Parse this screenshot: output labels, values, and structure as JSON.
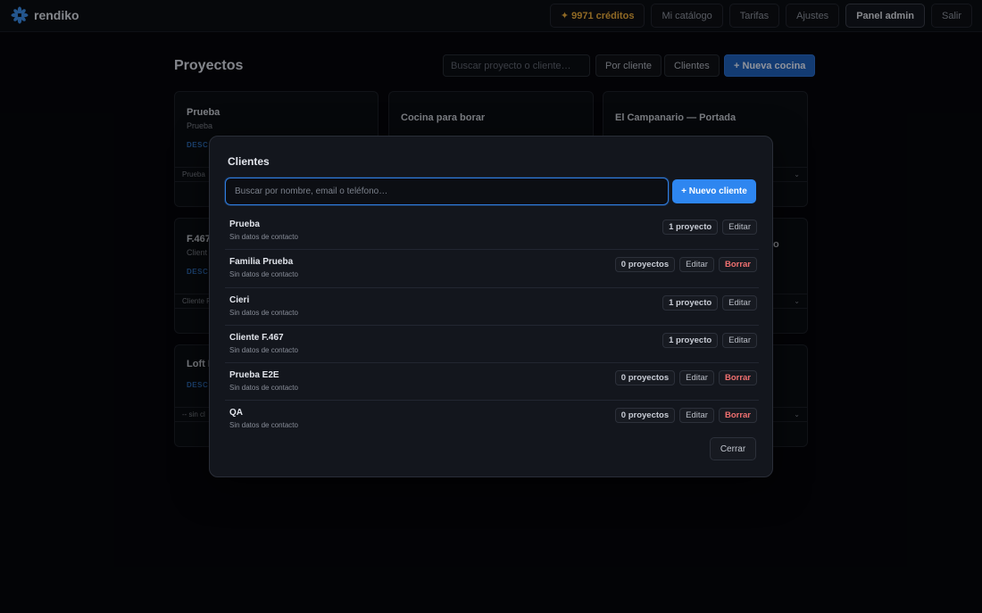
{
  "brand": {
    "name": "rendiko",
    "color": "#3a8ce6",
    "icon": "snowflake-logo-icon"
  },
  "nav": {
    "credits": "✦ 9971 créditos",
    "catalog": "Mi catálogo",
    "rates": "Tarifas",
    "settings": "Ajustes",
    "admin": "Panel admin",
    "logout": "Salir"
  },
  "header": {
    "title": "Proyectos",
    "search_placeholder": "Buscar proyecto o cliente…",
    "by_client": "Por cliente",
    "clients": "Clientes",
    "new_kitchen": "+ Nueva cocina"
  },
  "cards": [
    {
      "title": "Prueba",
      "subtitle": "Prueba",
      "tag": "DESC",
      "select": "Prueba"
    },
    {
      "title": "Cocina para borar",
      "subtitle": "",
      "tag": "",
      "select": ""
    },
    {
      "title": "El Campanario — Portada",
      "subtitle": "",
      "tag": "",
      "select": ""
    },
    {
      "title": "F.467",
      "subtitle": "Client",
      "tag": "DESC",
      "select": "Cliente F"
    },
    {
      "title": "",
      "subtitle": "",
      "tag": "",
      "select": ""
    },
    {
      "title": "o",
      "subtitle": "",
      "tag": "",
      "select": ""
    },
    {
      "title": "Loft F",
      "subtitle": "",
      "tag": "DESC",
      "select": "-- sin cl"
    },
    {
      "title": "",
      "subtitle": "",
      "tag": "",
      "select": ""
    }
  ],
  "modal": {
    "title": "Clientes",
    "search_placeholder": "Buscar por nombre, email o teléfono…",
    "new_client": "+ Nuevo cliente",
    "close": "Cerrar",
    "edit_label": "Editar",
    "delete_label": "Borrar",
    "clients": [
      {
        "name": "Prueba",
        "contact": "Sin datos de contacto",
        "projects": "1 proyecto",
        "deletable": false
      },
      {
        "name": "Familia Prueba",
        "contact": "Sin datos de contacto",
        "projects": "0 proyectos",
        "deletable": true
      },
      {
        "name": "Cieri",
        "contact": "Sin datos de contacto",
        "projects": "1 proyecto",
        "deletable": false
      },
      {
        "name": "Cliente F.467",
        "contact": "Sin datos de contacto",
        "projects": "1 proyecto",
        "deletable": false
      },
      {
        "name": "Prueba E2E",
        "contact": "Sin datos de contacto",
        "projects": "0 proyectos",
        "deletable": true
      },
      {
        "name": "QA",
        "contact": "Sin datos de contacto",
        "projects": "0 proyectos",
        "deletable": true
      }
    ]
  },
  "colors": {
    "accent": "#2e86f0",
    "danger": "#f07070",
    "credits": "#e7a93b"
  }
}
